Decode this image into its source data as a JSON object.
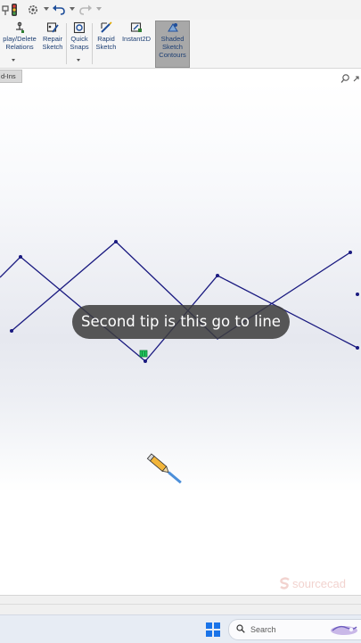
{
  "quick_access": {
    "icons": [
      "pin-icon",
      "traffic-light-icon",
      "options-gear-icon",
      "undo-icon",
      "redo-icon"
    ]
  },
  "ribbon": {
    "buttons": [
      {
        "key": "display_delete_relations",
        "label": "play/Delete\nRelations",
        "icon": "relations-icon"
      },
      {
        "key": "repair_sketch",
        "label": "Repair\nSketch",
        "icon": "repair-sketch-icon"
      },
      {
        "key": "quick_snaps",
        "label": "Quick\nSnaps",
        "icon": "quick-snaps-icon"
      },
      {
        "key": "rapid_sketch",
        "label": "Rapid\nSketch",
        "icon": "rapid-sketch-icon"
      },
      {
        "key": "instant2d",
        "label": "Instant2D",
        "icon": "instant2d-icon"
      },
      {
        "key": "shaded_sketch_contours",
        "label": "Shaded\nSketch\nContours",
        "icon": "shaded-contours-icon",
        "active": true
      }
    ]
  },
  "tabs": {
    "addins": "d-Ins"
  },
  "canvas": {
    "sketch_color": "#1a1a80",
    "relation_marker_color": "#22c55e",
    "caption": "Second tip is this go to line"
  },
  "watermark": {
    "text": "sourcecad",
    "color": "#f2d3cf"
  },
  "taskbar": {
    "search_placeholder": "Search",
    "accent": "#1a73e8"
  }
}
